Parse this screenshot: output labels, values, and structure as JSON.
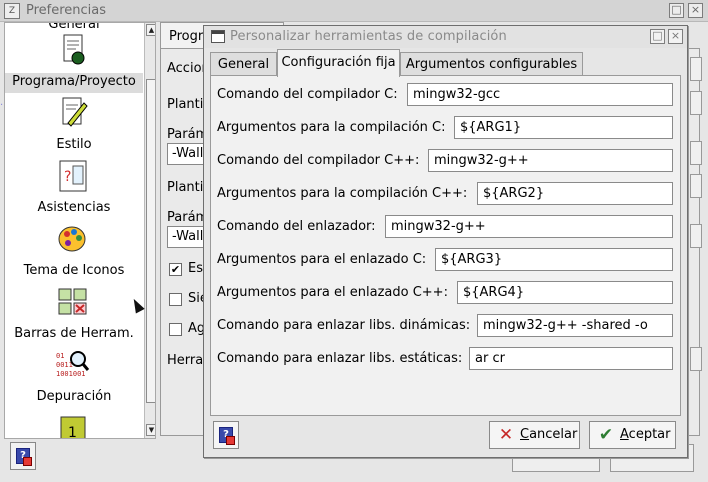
{
  "background_window": {
    "title": "Preferencias",
    "sidebar": {
      "items": [
        {
          "label": "General",
          "icon": "document-icon"
        },
        {
          "label": "Programa/Proyecto",
          "icon": "project-icon",
          "selected": true
        },
        {
          "label": "Estilo",
          "icon": "style-icon"
        },
        {
          "label": "Asistencias",
          "icon": "assist-icon"
        },
        {
          "label": "Tema de Iconos",
          "icon": "palette-icon"
        },
        {
          "label": "Barras de Herram.",
          "icon": "toolbars-icon"
        },
        {
          "label": "Depuración",
          "icon": "debug-icon"
        }
      ]
    },
    "panel": {
      "tab_label": "Progra",
      "labels": [
        "Accion",
        "Planti",
        "Parám",
        "Planti",
        "Parám",
        "Herra"
      ],
      "fields": [
        "-Wall",
        "-Wall"
      ],
      "checkboxes": [
        {
          "label": "Es",
          "checked": true,
          "mark": "✔"
        },
        {
          "label": "Sie",
          "checked": false,
          "mark": ""
        },
        {
          "label": "Ag",
          "checked": false,
          "mark": ""
        }
      ]
    }
  },
  "dialog": {
    "title": "Personalizar herramientas de compilación",
    "tabs": [
      {
        "label": "General"
      },
      {
        "label": "Configuración fija",
        "active": true
      },
      {
        "label": "Argumentos configurables"
      }
    ],
    "rows": [
      {
        "label": "Comando del compilador C:",
        "value": "mingw32-gcc"
      },
      {
        "label": "Argumentos para la compilación C:",
        "value": "${ARG1}"
      },
      {
        "label": "Comando del compilador C++:",
        "value": "mingw32-g++"
      },
      {
        "label": "Argumentos para la compilación C++:",
        "value": "${ARG2}"
      },
      {
        "label": "Comando del enlazador:",
        "value": "mingw32-g++"
      },
      {
        "label": "Argumentos para el enlazado C:",
        "value": "${ARG3}"
      },
      {
        "label": "Argumentos para el enlazado C++:",
        "value": "${ARG4}"
      },
      {
        "label": "Comando para enlazar libs. dinámicas:",
        "value": "mingw32-g++ -shared -o"
      },
      {
        "label": "Comando para enlazar libs. estáticas:",
        "value": "ar cr"
      }
    ],
    "buttons": {
      "cancel": {
        "mnemonic": "C",
        "rest": "ancelar",
        "icon": "cancel-icon"
      },
      "accept": {
        "mnemonic": "A",
        "rest": "ceptar",
        "icon": "accept-icon"
      }
    }
  },
  "colors": {
    "cancel_icon": "#c62828",
    "accept_icon": "#2e7d32"
  }
}
